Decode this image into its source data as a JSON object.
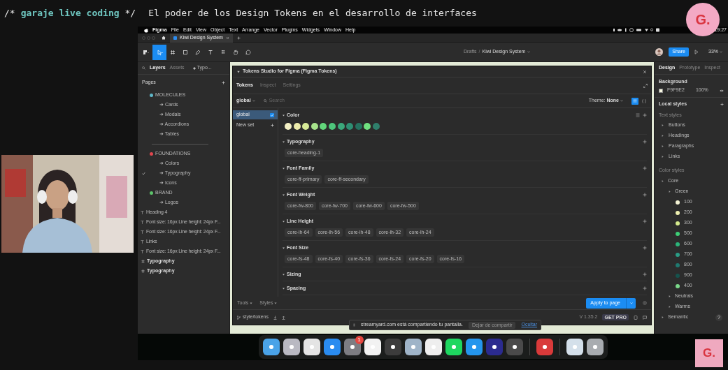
{
  "header": {
    "comment_open": "/*",
    "show_name": "garaje live coding",
    "comment_close": "*/",
    "title": "El poder de los Design Tokens en el desarrollo de interfaces"
  },
  "logo_top": "G.",
  "logo_bottom": "G.",
  "menubar": {
    "app": "Figma",
    "menus": [
      "File",
      "Edit",
      "View",
      "Object",
      "Text",
      "Arrange",
      "Vector",
      "Plugins",
      "Widgets",
      "Window",
      "Help"
    ],
    "time": "19:27"
  },
  "file_tabs": [
    {
      "label": "Kiwi Design System",
      "selected": true
    }
  ],
  "toolbar": {
    "tools": [
      {
        "kind": "menu",
        "selected": false
      },
      {
        "kind": "move",
        "selected": true
      },
      {
        "kind": "frame",
        "selected": false
      },
      {
        "kind": "shape",
        "selected": false
      },
      {
        "kind": "pen",
        "selected": false
      },
      {
        "kind": "text",
        "selected": false
      },
      {
        "kind": "component",
        "selected": false
      },
      {
        "kind": "hand",
        "selected": false
      },
      {
        "kind": "comment",
        "selected": false
      }
    ],
    "breadcrumb_root": "Drafts",
    "breadcrumb_separator": "/",
    "breadcrumb_file": "Kiwi Design System",
    "share": "Share",
    "zoom": "33%"
  },
  "left_panel": {
    "tabs": [
      {
        "label": "Layers",
        "selected": true
      },
      {
        "label": "Assets",
        "selected": false
      }
    ],
    "page_filter": "Typo...",
    "pages_title": "Pages",
    "pages": [
      {
        "kind": "section",
        "label": "MOLECULES",
        "color": "#5fb8c9",
        "current": false
      },
      {
        "kind": "page",
        "label": "➜ Cards",
        "current": false
      },
      {
        "kind": "page",
        "label": "➜ Modals",
        "current": false
      },
      {
        "kind": "page",
        "label": "➜ Accordions",
        "current": false
      },
      {
        "kind": "page",
        "label": "➜ Tables",
        "current": false
      },
      {
        "kind": "divider"
      },
      {
        "kind": "section",
        "label": "FOUNDATIONS",
        "color": "#e0464e",
        "current": false
      },
      {
        "kind": "page",
        "label": "➜ Colors",
        "current": false
      },
      {
        "kind": "page",
        "label": "➜ Typography",
        "current": true
      },
      {
        "kind": "page",
        "label": "➜ Icons",
        "current": false
      },
      {
        "kind": "section",
        "label": "BRAND",
        "color": "#5cc36a",
        "current": false
      },
      {
        "kind": "page",
        "label": "➜ Logos",
        "current": false
      }
    ],
    "layers": [
      {
        "kind": "text",
        "label": "Heading 4"
      },
      {
        "kind": "text",
        "label": "Font size: 16px Line height: 24px F..."
      },
      {
        "kind": "text",
        "label": "Font size: 16px Line height: 24px F..."
      },
      {
        "kind": "text",
        "label": "Links"
      },
      {
        "kind": "text",
        "label": "Font size: 16px Line height: 24px F..."
      },
      {
        "kind": "frame",
        "label": "Typography"
      },
      {
        "kind": "frame",
        "label": "Typography"
      }
    ]
  },
  "plugin": {
    "title": "Tokens Studio for Figma (Figma Tokens)",
    "tabs": [
      {
        "label": "Tokens",
        "selected": true
      },
      {
        "label": "Inspect",
        "selected": false
      },
      {
        "label": "Settings",
        "selected": false
      }
    ],
    "set_select": "global",
    "search_placeholder": "Search",
    "theme_label": "Theme:",
    "theme_value": "None",
    "view_modes": [
      {
        "kind": "list",
        "selected": true
      },
      {
        "kind": "json",
        "selected": false
      }
    ],
    "sets": [
      {
        "kind": "set",
        "label": "global",
        "selected": true,
        "checked": true
      },
      {
        "kind": "new",
        "label": "New set",
        "selected": false
      }
    ],
    "groups": [
      {
        "title": "Color",
        "swatches": [
          {
            "color": "#f3efc4"
          },
          {
            "color": "#ecebaa"
          },
          {
            "color": "#d6ea97"
          },
          {
            "color": "#a7e38b"
          },
          {
            "color": "#62d67b"
          },
          {
            "color": "#4dc57b"
          },
          {
            "color": "#3ba87b"
          },
          {
            "color": "#2e8f73"
          },
          {
            "color": "#25715f"
          },
          {
            "color": "#6fe07f"
          },
          {
            "color": "#2f7f6b"
          }
        ]
      },
      {
        "title": "Typography",
        "tokens": [
          "core-heading-1"
        ]
      },
      {
        "title": "Font Family",
        "tokens": [
          "core-ff-primary",
          "core-ff-secondary"
        ]
      },
      {
        "title": "Font Weight",
        "tokens": [
          "core-fw-800",
          "core-fw-700",
          "core-fw-600",
          "core-fw-500"
        ]
      },
      {
        "title": "Line Height",
        "tokens": [
          "core-lh-64",
          "core-lh-56",
          "core-lh-48",
          "core-lh-32",
          "core-lh-24"
        ]
      },
      {
        "title": "Font Size",
        "tokens": [
          "core-fs-48",
          "core-fs-40",
          "core-fs-36",
          "core-fs-24",
          "core-fs-20",
          "core-fs-16"
        ]
      },
      {
        "title": "Sizing"
      },
      {
        "title": "Spacing"
      }
    ],
    "tools": "Tools",
    "styles": "Styles",
    "apply": "Apply to page",
    "branch": "style/tokens",
    "version": "V 1.35.2",
    "get_pro": "GET PRO"
  },
  "share_notice": {
    "message": "streamyard.com está compartiendo tu pantalla.",
    "stop": "Dejar de compartir",
    "hide": "Ocultar"
  },
  "right_panel": {
    "tabs": [
      {
        "label": "Design",
        "selected": true
      },
      {
        "label": "Prototype",
        "selected": false
      },
      {
        "label": "Inspect",
        "selected": false
      }
    ],
    "background_title": "Background",
    "background_hex": "F9F9E2",
    "background_opacity": "100%",
    "local_styles": "Local styles",
    "text_styles_title": "Text styles",
    "text_styles": [
      "Buttons",
      "Headings",
      "Paragraphs",
      "Links"
    ],
    "color_styles_title": "Color styles",
    "color_tree": [
      {
        "label": "Core",
        "children": [
          {
            "label": "Green",
            "children": [
              {
                "label": "100",
                "color": "#f4f3d5"
              },
              {
                "label": "200",
                "color": "#eef0b0"
              },
              {
                "label": "300",
                "color": "#d6eb8d"
              },
              {
                "label": "500",
                "color": "#3dcf76"
              },
              {
                "label": "600",
                "color": "#2bb57a"
              },
              {
                "label": "700",
                "color": "#2a9d86"
              },
              {
                "label": "800",
                "color": "#1f7a70"
              },
              {
                "label": "900",
                "color": "#15534d"
              },
              {
                "label": "400",
                "color": "#7bd98a"
              }
            ]
          },
          {
            "label": "Neutrals"
          },
          {
            "label": "Warms"
          }
        ]
      },
      {
        "label": "Semantic"
      }
    ],
    "help": "?"
  },
  "dock": [
    {
      "kind": "app",
      "color": "#4aa3e8"
    },
    {
      "kind": "app",
      "color": "#b9b9c2"
    },
    {
      "kind": "app",
      "color": "#e4e4e4"
    },
    {
      "kind": "app",
      "color": "#2a8cf0"
    },
    {
      "kind": "app",
      "color": "#7d7d82",
      "badge": "1"
    },
    {
      "kind": "app",
      "color": "#f2f2f2"
    },
    {
      "kind": "app",
      "color": "#3c3c3c"
    },
    {
      "kind": "app",
      "color": "#9fb4c8"
    },
    {
      "kind": "app",
      "color": "#eeeeee"
    },
    {
      "kind": "app",
      "color": "#1ed760"
    },
    {
      "kind": "app",
      "color": "#2496ed"
    },
    {
      "kind": "app",
      "color": "#2b2b8f"
    },
    {
      "kind": "app",
      "color": "#4a4a4a"
    },
    {
      "kind": "separator"
    },
    {
      "kind": "app",
      "color": "#d93a3a"
    },
    {
      "kind": "separator"
    },
    {
      "kind": "app",
      "color": "#d4e0ea"
    },
    {
      "kind": "app",
      "color": "#a8acb0"
    }
  ]
}
